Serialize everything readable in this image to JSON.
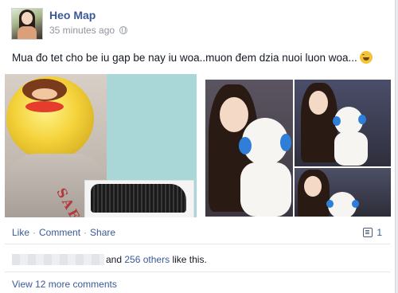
{
  "post": {
    "author": "Heo Map",
    "timestamp": "35 minutes ago",
    "privacy_icon": "globe-icon",
    "status_text": "Mua đo tet cho be iu gap be nay iu woa..muon đem dzia nuoi luon woa...",
    "emoji_icon": "laughing-face-icon",
    "photo_left_text": "SAFETY DOG"
  },
  "actions": {
    "like": "Like",
    "comment": "Comment",
    "share": "Share",
    "separator": "·",
    "comment_count": "1"
  },
  "likes": {
    "and_text": "and",
    "others": "256 others",
    "suffix": "like this."
  },
  "comments": {
    "view_more": "View 12 more comments"
  },
  "colors": {
    "link": "#3b5998",
    "text": "#141823",
    "meta": "#90949c"
  }
}
